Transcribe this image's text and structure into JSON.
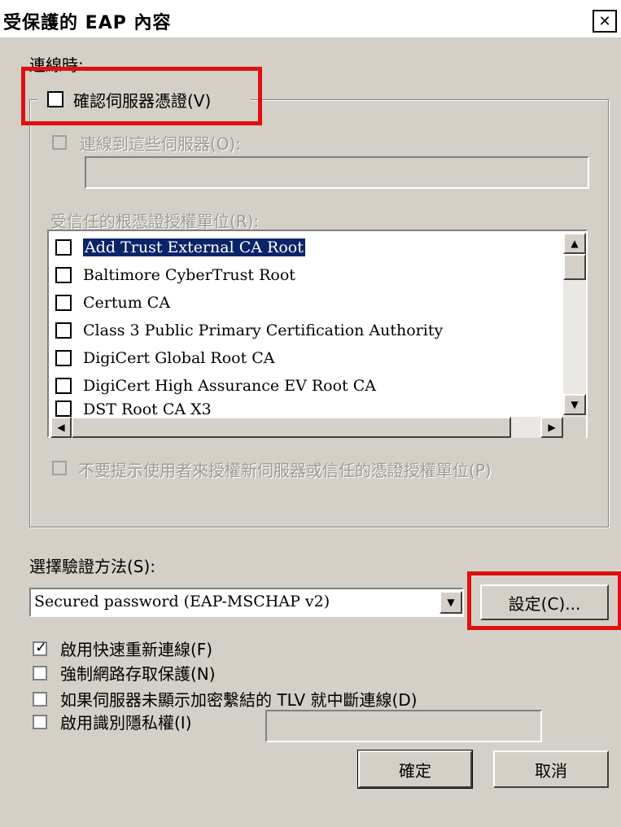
{
  "window": {
    "title": "受保護的 EAP 內容",
    "close_symbol": "✕"
  },
  "connect": {
    "heading": "連線時:",
    "verify_cert_label": "確認伺服器憑證(V)",
    "connect_servers_label": "連線到這些伺服器(O):",
    "connect_servers_value": "",
    "trusted_roots_label": "受信任的根憑證授權單位(R):"
  },
  "cert_list": {
    "items": [
      {
        "label": "Add Trust External CA Root",
        "checked": false,
        "selected": true
      },
      {
        "label": "Baltimore CyberTrust Root",
        "checked": false,
        "selected": false
      },
      {
        "label": "Certum CA",
        "checked": false,
        "selected": false
      },
      {
        "label": "Class 3 Public Primary Certification Authority",
        "checked": false,
        "selected": false
      },
      {
        "label": "DigiCert Global Root CA",
        "checked": false,
        "selected": false
      },
      {
        "label": "DigiCert High Assurance EV Root CA",
        "checked": false,
        "selected": false
      },
      {
        "label": "DST Root CA X3",
        "checked": false,
        "selected": false
      }
    ]
  },
  "no_prompt_label": "不要提示使用者來授權新伺服器或信任的憑證授權單位(P)",
  "auth": {
    "heading": "選擇驗證方法(S):",
    "method_value": "Secured password (EAP-MSCHAP v2)",
    "configure_label": "設定(C)..."
  },
  "options": {
    "fast_reconnect_label": "啟用快速重新連線(F)",
    "fast_reconnect_checked": true,
    "nap_label": "強制網路存取保護(N)",
    "nap_checked": false,
    "tlv_label": "如果伺服器未顯示加密繫結的 TLV 就中斷連線(D)",
    "tlv_checked": false,
    "privacy_label": "啟用識別隱私權(I)",
    "privacy_checked": false,
    "privacy_value": ""
  },
  "buttons": {
    "ok_label": "確定",
    "cancel_label": "取消"
  },
  "colors": {
    "dialog_bg": "#d4d0c8",
    "highlight": "#0a246a",
    "annotation_red": "#e01010"
  }
}
